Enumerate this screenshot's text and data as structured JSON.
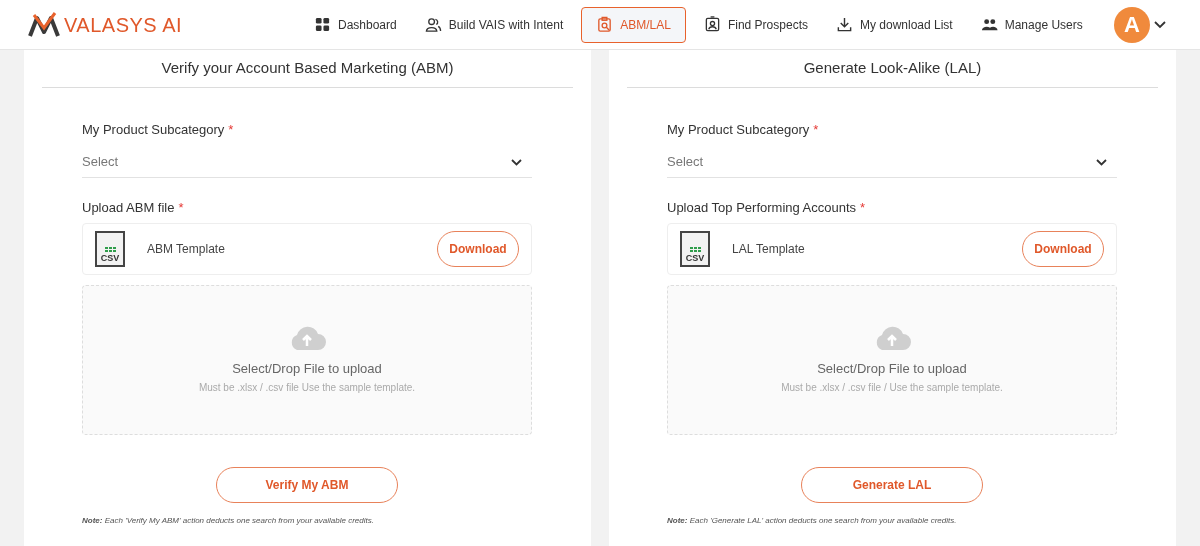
{
  "header": {
    "logo": "VALASYS AI",
    "nav": [
      {
        "label": "Dashboard",
        "selected": false
      },
      {
        "label": "Build VAIS with Intent",
        "selected": false
      },
      {
        "label": "ABM/LAL",
        "selected": true
      },
      {
        "label": "Find Prospects",
        "selected": false
      },
      {
        "label": "My download List",
        "selected": false
      },
      {
        "label": "Manage Users",
        "selected": false
      }
    ],
    "avatar": "A"
  },
  "panels": [
    {
      "title": "Verify your Account Based Marketing (ABM)",
      "subcategory_label": "My Product Subcategory",
      "required_mark": "*",
      "select_placeholder": "Select",
      "upload_label": "Upload ABM file",
      "template_name": "ABM Template",
      "file_badge": "CSV",
      "download": "Download",
      "drop_title": "Select/Drop File to upload",
      "drop_hint": "Must be .xlsx / .csv file Use the sample template.",
      "action": "Verify My ABM",
      "note": "**Note:** Each 'Verify My ABM' action deducts one search from your available credits."
    },
    {
      "title": "Generate Look-Alike (LAL)",
      "subcategory_label": "My Product Subcategory",
      "required_mark": "*",
      "select_placeholder": "Select",
      "upload_label": "Upload Top Performing Accounts",
      "template_name": "LAL Template",
      "file_badge": "CSV",
      "download": "Download",
      "drop_title": "Select/Drop File to upload",
      "drop_hint": "Must be .xlsx / .csv file / Use the sample template.",
      "action": "Generate LAL",
      "note": "**Note:** Each 'Generate LAL' action deducts one search from your available credits."
    }
  ]
}
